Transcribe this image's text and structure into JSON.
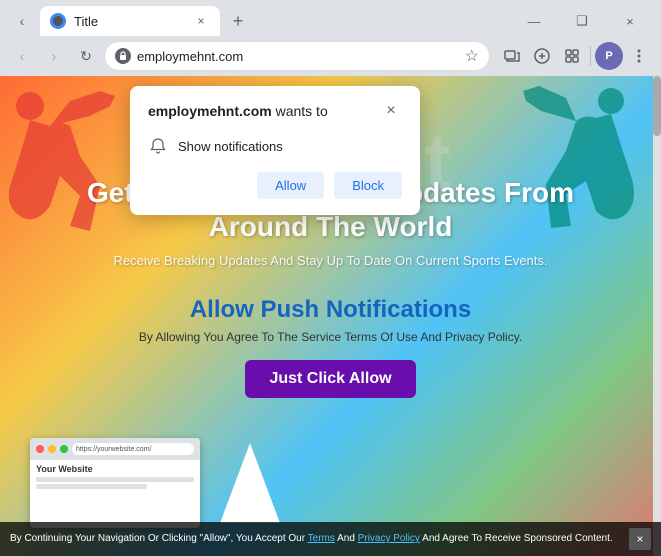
{
  "browser": {
    "tab_favicon": "●",
    "tab_title": "Title",
    "tab_close": "×",
    "new_tab": "+",
    "win_min": "—",
    "win_restore": "❑",
    "win_close": "×",
    "nav_back": "‹",
    "nav_forward": "›",
    "nav_refresh": "↻",
    "omnibox_url": "employmehnt.com",
    "omnibox_star": "☆",
    "toolbar_icons": [
      "M",
      "⊘",
      "☰"
    ],
    "menu_icon": "⋮"
  },
  "notification_popup": {
    "title_plain": "employmehnt.com",
    "title_suffix": " wants to",
    "close_icon": "×",
    "permission_label": "Show notifications",
    "allow_label": "Allow",
    "block_label": "Block"
  },
  "hero": {
    "watermark": "egrunt",
    "title": "Get The Latest Sports Updates From Around The World",
    "subtitle": "Receive Breaking Updates And Stay Up To Date On Current Sports Events."
  },
  "push_section": {
    "title": "Allow Push Notifications",
    "subtitle": "By Allowing You Agree To The Service Terms Of Use And Privacy Policy.",
    "cta_label": "Just Click Allow"
  },
  "footer": {
    "text_main": "By Continuing Your Navigation Or Clicking \"Allow\", You Accept Our ",
    "link1": "Terms",
    "text_mid": " And ",
    "link2": "Privacy Policy",
    "text_end": " And Agree To Receive Sponsored Content.",
    "close_icon": "×"
  },
  "preview_card": {
    "dots": [
      "#ff5f57",
      "#ffbd2e",
      "#28c840"
    ],
    "url": "https://yourwebsite.com/",
    "label": "Your Website"
  }
}
